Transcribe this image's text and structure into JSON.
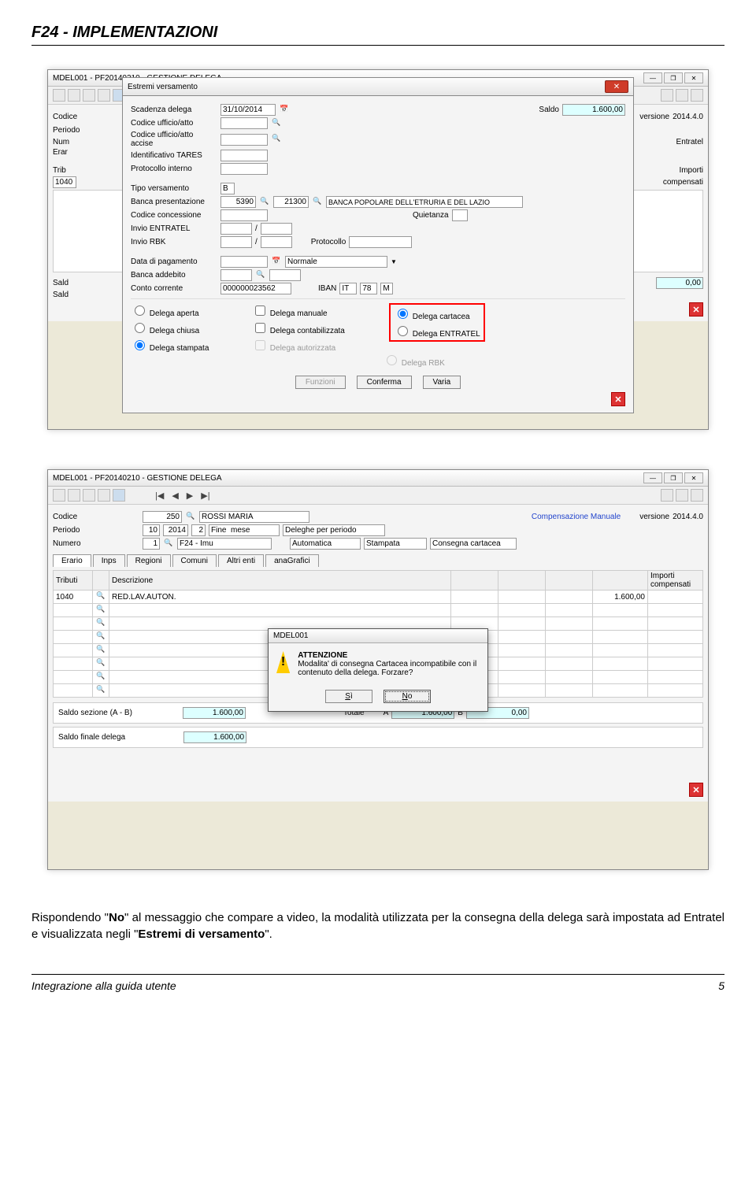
{
  "page": {
    "title": "F24 - IMPLEMENTAZIONI",
    "footer_left": "Integrazione alla guida utente",
    "footer_right": "5"
  },
  "win": {
    "title": "MDEL001  - PF20140210 -  GESTIONE DELEGA",
    "minimize": "—",
    "restore": "❐",
    "close": "✕"
  },
  "form": {
    "codice_lbl": "Codice",
    "codice": "250",
    "cliente": "ROSSI MARIA",
    "compman": "Compensazione Manuale",
    "versione_lbl": "versione",
    "versione": "2014.4.0",
    "periodo_lbl": "Periodo",
    "per_m": "10",
    "per_y": "2014",
    "per_n": "2",
    "finemese": "Fine  mese",
    "deleghe": "Deleghe per periodo",
    "numero_lbl": "Numero",
    "numero": "1",
    "f24imu": "F24 - Imu",
    "automatica": "Automatica",
    "stampata": "Stampata",
    "consegna": "Consegna cartacea",
    "entratel": "Entratel"
  },
  "tabs": {
    "erario": "Erario",
    "inps": "Inps",
    "regioni": "Regioni",
    "comuni": "Comuni",
    "altri": "Altri enti",
    "ana": "anaGrafici"
  },
  "cols": {
    "tributi": "Tributi",
    "descr": "Descrizione",
    "importi": "Importi",
    "compensati": "compensati"
  },
  "rowdata": {
    "cod": "1040",
    "descr": "RED.LAV.AUTON.",
    "imp": "1.600,00"
  },
  "summary": {
    "saldosez_lbl": "Saldo sezione (A - B)",
    "saldosez": "1.600,00",
    "totale_lbl": "Totale",
    "A": "A",
    "Aval": "1.600,00",
    "B": "B",
    "Bval": "0,00",
    "saldofin_lbl": "Saldo finale delega",
    "saldofin": "1.600,00",
    "sald": "Sald"
  },
  "dlg": {
    "title": "Estremi versamento",
    "scadenza_lbl": "Scadenza delega",
    "scadenza": "31/10/2014",
    "saldo_lbl": "Saldo",
    "saldo": "1.600,00",
    "cod_uff": "Codice ufficio/atto",
    "cod_acc": "Codice ufficio/atto accise",
    "id_tares": "Identificativo TARES",
    "prot_int": "Protocollo interno",
    "tipo_lbl": "Tipo versamento",
    "tipo": "B",
    "banca_lbl": "Banca presentazione",
    "banca_abi": "5390",
    "banca_cab": "21300",
    "banca_nome": "BANCA POPOLARE DELL'ETRURIA E DEL LAZIO",
    "conc_lbl": "Codice concessione",
    "quiet_lbl": "Quietanza",
    "invio_ent": "Invio ENTRATEL",
    "invio_rbk": "Invio RBK",
    "protocollo": "Protocollo",
    "datapag": "Data di pagamento",
    "normale": "Normale",
    "bancaadd": "Banca addebito",
    "cc_lbl": "Conto corrente",
    "cc": "000000023562",
    "iban_lbl": "IBAN",
    "iban_c": "IT",
    "iban_n": "78",
    "iban_l": "M",
    "r_aperta": "Delega aperta",
    "r_chiusa": "Delega chiusa",
    "r_stampata": "Delega stampata",
    "c_manuale": "Delega manuale",
    "c_contab": "Delega contabilizzata",
    "c_autor": "Delega autorizzata",
    "r_cart": "Delega cartacea",
    "r_entr": "Delega ENTRATEL",
    "r_rbk": "Delega RBK",
    "b_funz": "Funzioni",
    "b_conf": "Conferma",
    "b_varia": "Varia"
  },
  "msg": {
    "title": "MDEL001",
    "head": "ATTENZIONE",
    "body": "Modalita' di consegna Cartacea incompatibile con il contenuto della delega. Forzare?",
    "si": "Sì",
    "no": "No",
    "si_u": "S",
    "no_u": "N"
  },
  "text": {
    "p1a": "Rispondendo \"",
    "p1b": "No",
    "p1c": "\" al messaggio che compare a video, la modalità utilizzata per la consegna della delega sarà impostata ad Entratel e visualizzata negli \"",
    "p1d": "Estremi di versamento",
    "p1e": "\"."
  }
}
